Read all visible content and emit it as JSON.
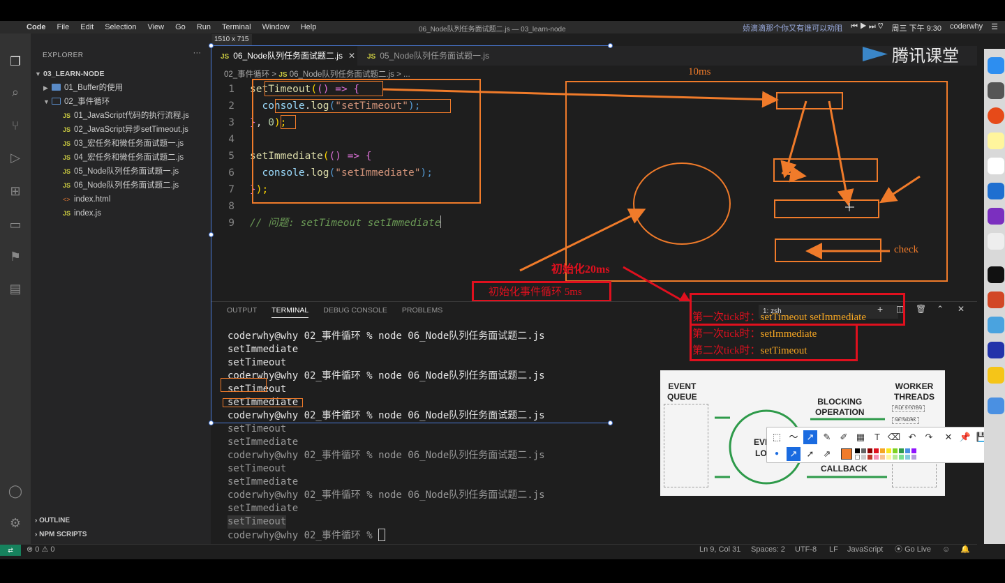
{
  "window": {
    "title": "06_Node队列任务面试题二.js — 03_learn-node",
    "capture_size": "1510 x 715"
  },
  "menubar": {
    "app": "Code",
    "items": [
      "File",
      "Edit",
      "Selection",
      "View",
      "Go",
      "Run",
      "Terminal",
      "Window",
      "Help"
    ],
    "ticker": "娇滴滴那个你又有谁可以劝阻",
    "clock": "周三 下午 9:30",
    "user": "coderwhy"
  },
  "watermark": "腾讯课堂",
  "explorer": {
    "header": "EXPLORER",
    "root": "03_LEARN-NODE",
    "folders": [
      {
        "label": "01_Buffer的使用",
        "open": false
      },
      {
        "label": "02_事件循环",
        "open": true
      }
    ],
    "files": [
      {
        "label": "01_JavaScript代码的执行流程.js",
        "type": "JS"
      },
      {
        "label": "02_JavaScript异步setTimeout.js",
        "type": "JS"
      },
      {
        "label": "03_宏任务和微任务面试题一.js",
        "type": "JS"
      },
      {
        "label": "04_宏任务和微任务面试题二.js",
        "type": "JS"
      },
      {
        "label": "05_Node队列任务面试题一.js",
        "type": "JS"
      },
      {
        "label": "06_Node队列任务面试题二.js",
        "type": "JS"
      },
      {
        "label": "index.html",
        "type": "<>"
      },
      {
        "label": "index.js",
        "type": "JS"
      }
    ],
    "outline": "OUTLINE",
    "npm": "NPM SCRIPTS"
  },
  "tabs": [
    {
      "label": "06_Node队列任务面试题二.js",
      "active": true,
      "icon": "JS"
    },
    {
      "label": "05_Node队列任务面试题一.js",
      "active": false,
      "icon": "JS"
    }
  ],
  "breadcrumb": {
    "folder": "02_事件循环",
    "sep": ">",
    "file": "06_Node队列任务面试题二.js",
    "tail": "> ..."
  },
  "code": {
    "line_numbers": [
      "1",
      "2",
      "3",
      "4",
      "5",
      "6",
      "7",
      "8",
      "9"
    ],
    "l1a": "setTimeout",
    "l1b": "(",
    "l1c": "() => {",
    "l2a": "console",
    "l2b": ".",
    "l2c": "log",
    "l2d": "(",
    "l2e": "\"setTimeout\"",
    "l2f": ");",
    "l3a": "}",
    "l3b": ", ",
    "l3c": "0",
    "l3d": ");",
    "l5a": "setImmediate",
    "l5b": "(",
    "l5c": "() => {",
    "l6a": "console",
    "l6b": ".",
    "l6c": "log",
    "l6d": "(",
    "l6e": "\"setImmediate\"",
    "l6f": ");",
    "l7a": "}",
    "l7b": ");",
    "l9": "// 问题: setTimeout setImmediate"
  },
  "diagram": {
    "label_10ms": "10ms",
    "label_check": "check",
    "init_loop": "初始化事件循环 5ms",
    "init_20ms": "初始化20ms",
    "tick1_a": "第一次tick时：",
    "tick1_a_val": "setTimeout setImmediate",
    "tick1_b": "第一次tick时：",
    "tick1_b_val": "setImmediate",
    "tick2": "第二次tick时：",
    "tick2_val": "setTimeout"
  },
  "panel": {
    "tabs": [
      "OUTPUT",
      "TERMINAL",
      "DEBUG CONSOLE",
      "PROBLEMS"
    ],
    "active_tab": "TERMINAL",
    "shell": "1: zsh",
    "lines": [
      {
        "text": "coderwhy@why 02_事件循环 % node 06_Node队列任务面试题二.js",
        "dim": false
      },
      {
        "text": "setImmediate",
        "dim": false
      },
      {
        "text": "setTimeout",
        "dim": false
      },
      {
        "text": "coderwhy@why 02_事件循环 % node 06_Node队列任务面试题二.js",
        "dim": false
      },
      {
        "text": "setTimeout",
        "dim": false
      },
      {
        "text": "setImmediate",
        "dim": false
      },
      {
        "text": "coderwhy@why 02_事件循环 % node 06_Node队列任务面试题二.js",
        "dim": false
      },
      {
        "text": "setTimeout",
        "dim": true
      },
      {
        "text": "setImmediate",
        "dim": true
      },
      {
        "text": "coderwhy@why 02_事件循环 % node 06_Node队列任务面试题二.js",
        "dim": true
      },
      {
        "text": "setTimeout",
        "dim": true
      },
      {
        "text": "setImmediate",
        "dim": true
      },
      {
        "text": "coderwhy@why 02_事件循环 % node 06_Node队列任务面试题二.js",
        "dim": true
      },
      {
        "text": "setImmediate",
        "dim": true
      },
      {
        "text": "setTimeout",
        "dim": true
      },
      {
        "text": "coderwhy@why 02_事件循环 % ",
        "dim": true
      }
    ]
  },
  "statusbar": {
    "problems": "⊗ 0 ⚠ 0",
    "position": "Ln 9, Col 31",
    "spaces": "Spaces: 2",
    "encoding": "UTF-8",
    "eol": "LF",
    "language": "JavaScript",
    "golive": "Go Live"
  },
  "figure": {
    "event_queue": "EVENT\nQUEUE",
    "worker_threads": "WORKER\nTHREADS",
    "blocking": "BLOCKING\nOPERATION",
    "callback": "CALLBACK",
    "event_loop_a": "EVE",
    "event_loop_b": "LO",
    "fs": "FILE SYSTEM",
    "network": "NETWORK"
  },
  "colors": {
    "annotation_orange": "#f07b2a",
    "annotation_red": "#e0101e",
    "selection_blue": "#4a7bd8"
  }
}
